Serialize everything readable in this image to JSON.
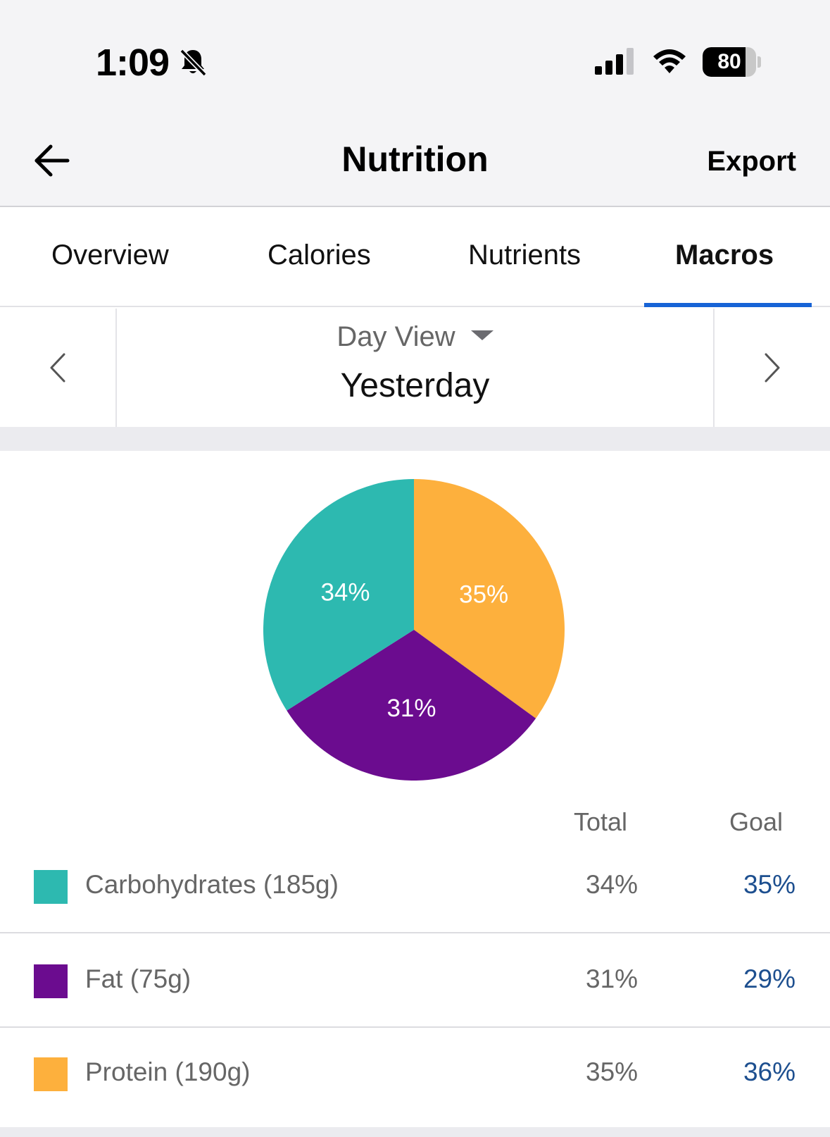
{
  "status_bar": {
    "time": "1:09",
    "battery_level": "80",
    "icons": [
      "bell-slash-icon",
      "cellular-signal-icon",
      "wifi-icon",
      "battery-icon"
    ]
  },
  "nav": {
    "title": "Nutrition",
    "export_label": "Export",
    "back_icon": "arrow-left-icon"
  },
  "tabs": [
    {
      "label": "Overview",
      "active": false
    },
    {
      "label": "Calories",
      "active": false
    },
    {
      "label": "Nutrients",
      "active": false
    },
    {
      "label": "Macros",
      "active": true
    }
  ],
  "date_selector": {
    "view_mode": "Day View",
    "date_label": "Yesterday",
    "prev_icon": "chevron-left-icon",
    "next_icon": "chevron-right-icon"
  },
  "macro_table": {
    "total_header": "Total",
    "goal_header": "Goal",
    "rows": [
      {
        "name": "Carbohydrates (185g)",
        "total": "34%",
        "goal": "35%",
        "color": "#2db9b0"
      },
      {
        "name": "Fat (75g)",
        "total": "31%",
        "goal": "29%",
        "color": "#6b0c8f"
      },
      {
        "name": "Protein (190g)",
        "total": "35%",
        "goal": "36%",
        "color": "#fdb03d"
      }
    ]
  },
  "chart_data": {
    "type": "pie",
    "categories": [
      "Protein",
      "Fat",
      "Carbohydrates"
    ],
    "values": [
      35,
      31,
      34
    ],
    "labels": [
      "35%",
      "31%",
      "34%"
    ],
    "colors": [
      "#fdb03d",
      "#6b0c8f",
      "#2db9b0"
    ],
    "start_angle": "top",
    "direction": "clockwise",
    "title": "",
    "xlabel": "",
    "ylabel": ""
  },
  "theme": {
    "accent": "#1763d6",
    "goal_text": "#1d4f8f"
  }
}
